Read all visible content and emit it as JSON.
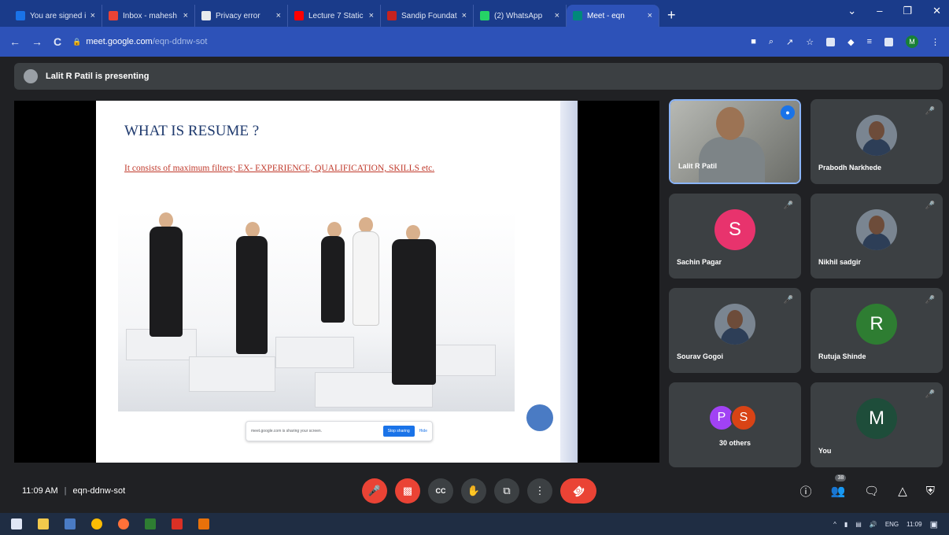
{
  "browser": {
    "tabs": [
      {
        "label": "You are signed i",
        "favicon_color": "#1a73e8"
      },
      {
        "label": "Inbox - mahesh",
        "favicon_color": "#ea4335"
      },
      {
        "label": "Privacy error",
        "favicon_color": "#e8eaed"
      },
      {
        "label": "Lecture 7 Static",
        "favicon_color": "#ff0000"
      },
      {
        "label": "Sandip Foundati",
        "favicon_color": "#c5221f"
      },
      {
        "label": "(2) WhatsApp",
        "favicon_color": "#25d366"
      },
      {
        "label": "Meet - eqn",
        "favicon_color": "#00897b",
        "active": true
      }
    ],
    "close_glyph": "×",
    "new_tab_glyph": "+",
    "window_controls": [
      "⌄",
      "–",
      "❐",
      "✕"
    ],
    "back_glyph": "←",
    "forward_glyph": "→",
    "reload_glyph": "C",
    "url_host": "meet.google.com",
    "url_path": "/eqn-ddnw-sot",
    "profile_initial": "M"
  },
  "presenting": {
    "text": "Lalit R Patil is presenting"
  },
  "slide": {
    "title": "WHAT IS RESUME ?",
    "body": "It consists of maximum filters; EX- EXPERIENCE, QUALIFICATION, SKILLS etc.",
    "share_notice": "meet.google.com is sharing your screen.",
    "stop_label": "Stop sharing",
    "hide_label": "Hide"
  },
  "participants": [
    {
      "name": "Lalit R Patil",
      "type": "video",
      "speaking": true
    },
    {
      "name": "Prabodh Narkhede",
      "type": "photo"
    },
    {
      "name": "Sachin Pagar",
      "type": "initial",
      "initial": "S",
      "color": "#e8336d"
    },
    {
      "name": "Nikhil sadgir",
      "type": "photo"
    },
    {
      "name": "Sourav Gogoi",
      "type": "photo"
    },
    {
      "name": "Rutuja Shinde",
      "type": "initial",
      "initial": "R",
      "color": "#2e7d32"
    },
    {
      "name": "30 others",
      "type": "others",
      "initials": [
        "P",
        "S"
      ],
      "colors": [
        "#a142f4",
        "#d84315"
      ]
    },
    {
      "name": "You",
      "type": "initial",
      "initial": "M",
      "color": "#1e4d3a"
    }
  ],
  "meeting": {
    "time": "11:09 AM",
    "separator": "|",
    "code": "eqn-ddnw-sot",
    "participant_count": "38"
  },
  "controls": {
    "mic": "mic-off-icon",
    "camera": "camera-off-icon",
    "captions": "CC",
    "raise_hand": "✋",
    "present": "⧉",
    "more": "⋮",
    "end_call": "☎"
  },
  "taskbar": {
    "tray": [
      "^",
      "ENG",
      "11:09"
    ]
  }
}
